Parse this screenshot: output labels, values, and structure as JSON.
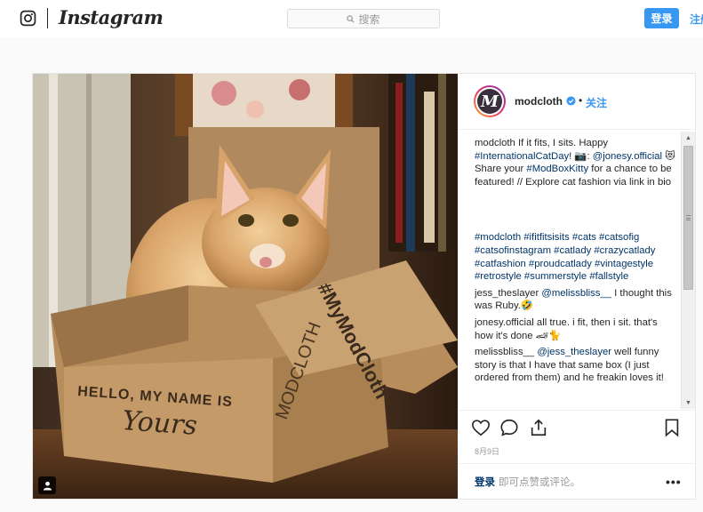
{
  "header": {
    "logo_text": "Instagram",
    "search_placeholder": "搜索",
    "login_button": "登录",
    "signup_link": "注册"
  },
  "post": {
    "author": "modcloth",
    "avatar_letter": "M",
    "separator": "•",
    "follow_label": "关注",
    "comments": [
      {
        "user": "modcloth",
        "segments": [
          {
            "t": "If it fits, I sits. Happy "
          },
          {
            "t": "#InternationalCatDay",
            "tag": true
          },
          {
            "t": "! 📷: "
          },
          {
            "t": "@jonesy.official",
            "tag": true
          },
          {
            "t": " 😻 Share your "
          },
          {
            "t": "#ModBoxKitty",
            "tag": true
          },
          {
            "t": " for a chance to be featured! // Explore cat fashion via link in bio"
          }
        ]
      },
      {
        "user": "",
        "segments": [
          {
            "t": "#modcloth",
            "tag": true
          },
          {
            "t": " "
          },
          {
            "t": "#ifitfitsisits",
            "tag": true
          },
          {
            "t": " "
          },
          {
            "t": "#cats",
            "tag": true
          },
          {
            "t": " "
          },
          {
            "t": "#catsofig",
            "tag": true
          },
          {
            "t": " "
          },
          {
            "t": "#catsofinstagram",
            "tag": true
          },
          {
            "t": " "
          },
          {
            "t": "#catlady",
            "tag": true
          },
          {
            "t": " "
          },
          {
            "t": "#crazycatlady",
            "tag": true
          },
          {
            "t": " "
          },
          {
            "t": "#catfashion",
            "tag": true
          },
          {
            "t": " "
          },
          {
            "t": "#proudcatlady",
            "tag": true
          },
          {
            "t": " "
          },
          {
            "t": "#vintagestyle",
            "tag": true
          },
          {
            "t": " "
          },
          {
            "t": "#retrostyle",
            "tag": true
          },
          {
            "t": " "
          },
          {
            "t": "#summerstyle",
            "tag": true
          },
          {
            "t": " "
          },
          {
            "t": "#fallstyle",
            "tag": true
          }
        ]
      },
      {
        "user": "jess_theslayer",
        "segments": [
          {
            "t": "@melissbliss__",
            "tag": true
          },
          {
            "t": " I thought this was Ruby.🤣"
          }
        ]
      },
      {
        "user": "jonesy.official",
        "segments": [
          {
            "t": "all true. i fit, then i sit. that's how it's done 🏎🐈"
          }
        ]
      },
      {
        "user": "melissbliss__",
        "segments": [
          {
            "t": "@jess_theslayer",
            "tag": true
          },
          {
            "t": " well funny story is that I have that same box (I just ordered from them) and he freakin loves it!"
          }
        ]
      }
    ],
    "date": "8月9日",
    "bottom_login": "登录",
    "bottom_hint": "即可点赞或评论。",
    "more_label": "•••"
  },
  "photo": {
    "box_text_hello": "HELLO, MY NAME IS",
    "box_text_yours": "Yours",
    "box_text_hashtag": "#MyModCloth",
    "box_text_side": "MODCLOTH"
  },
  "colors": {
    "accent": "#3897f0",
    "link": "#003569",
    "text": "#262626",
    "muted": "#999999"
  },
  "icons": [
    "camera-icon",
    "search-icon",
    "verified-icon",
    "heart-icon",
    "comment-icon",
    "share-icon",
    "bookmark-icon",
    "user-tag-icon"
  ]
}
